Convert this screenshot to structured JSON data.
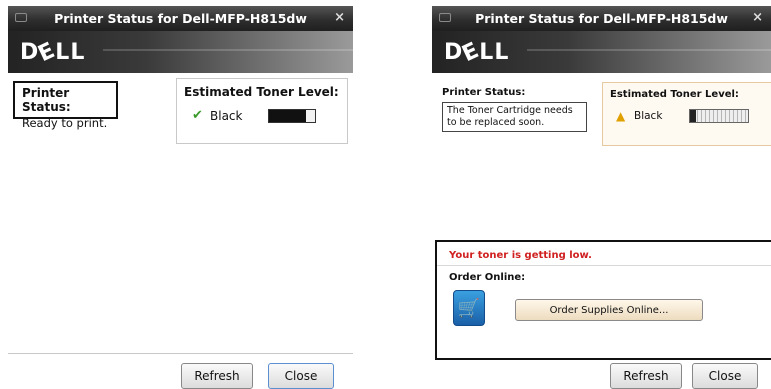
{
  "windows": [
    {
      "title": "Printer Status for Dell-MFP-H815dw",
      "logo": "DELL",
      "status_label": "Printer Status:",
      "status_value": "Ready to print.",
      "toner_label": "Estimated Toner Level:",
      "toner_name": "Black",
      "toner_level": 0.8,
      "refresh_label": "Refresh",
      "close_label": "Close",
      "icons": {
        "toner_status": "check-icon",
        "close": "close-icon",
        "menu": "window-menu-icon"
      }
    },
    {
      "title": "Printer Status for Dell-MFP-H815dw",
      "logo": "DELL",
      "status_label": "Printer Status:",
      "status_value": "The Toner Cartridge needs to be replaced soon.",
      "toner_label": "Estimated Toner Level:",
      "toner_name": "Black",
      "toner_level": 0.1,
      "low_message": "Your toner is getting low.",
      "order_label": "Order Online:",
      "order_button": "Order Supplies Online...",
      "refresh_label": "Refresh",
      "close_label": "Close",
      "colors": {
        "warning_text": "#d02020"
      },
      "icons": {
        "toner_status": "warning-icon",
        "cart": "shopping-cart-icon",
        "close": "close-icon",
        "menu": "window-menu-icon"
      }
    }
  ]
}
